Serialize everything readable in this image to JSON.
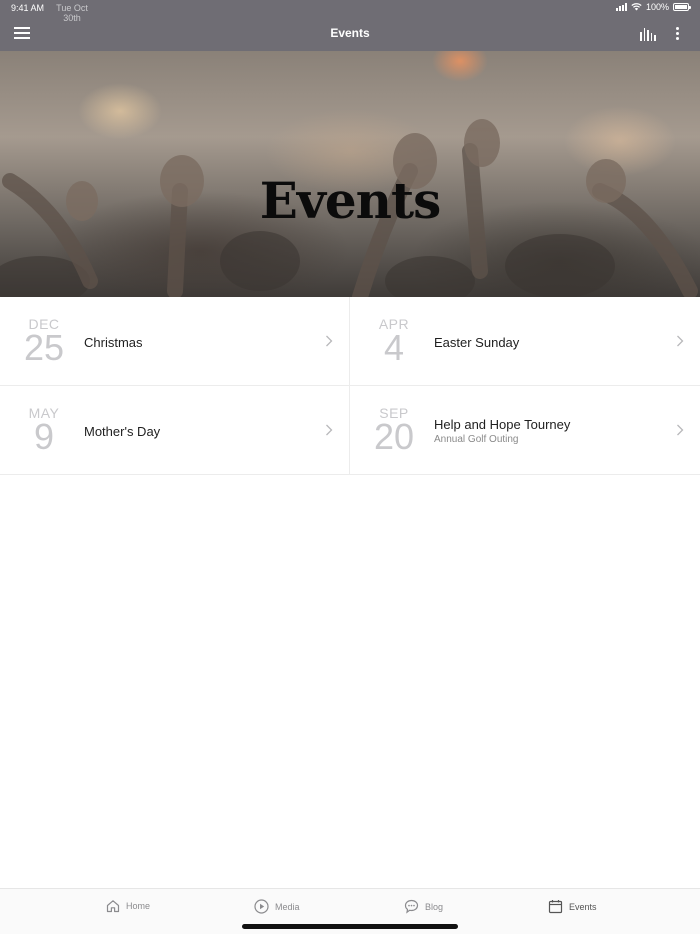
{
  "status_bar": {
    "time": "9:41 AM",
    "date": "Tue Oct 30th",
    "battery": "100%"
  },
  "header": {
    "title": "Events",
    "left_icon": "hamburger-menu-icon",
    "right_icons": [
      "audio-bars-icon",
      "more-vertical-icon"
    ],
    "background_color": "#6f6d74"
  },
  "hero": {
    "title": "Events",
    "image_description": "concert crowd with raised hands"
  },
  "events": [
    {
      "month": "DEC",
      "day": "25",
      "title": "Christmas",
      "subtitle": ""
    },
    {
      "month": "APR",
      "day": "4",
      "title": "Easter Sunday",
      "subtitle": ""
    },
    {
      "month": "MAY",
      "day": "9",
      "title": "Mother's Day",
      "subtitle": ""
    },
    {
      "month": "SEP",
      "day": "20",
      "title": "Help and Hope Tourney",
      "subtitle": "Annual Golf Outing"
    }
  ],
  "tabbar": {
    "items": [
      {
        "label": "Home",
        "icon": "home-icon"
      },
      {
        "label": "Media",
        "icon": "play-circle-icon"
      },
      {
        "label": "Blog",
        "icon": "chat-bubble-icon"
      },
      {
        "label": "Events",
        "icon": "calendar-icon",
        "active": true
      }
    ]
  }
}
